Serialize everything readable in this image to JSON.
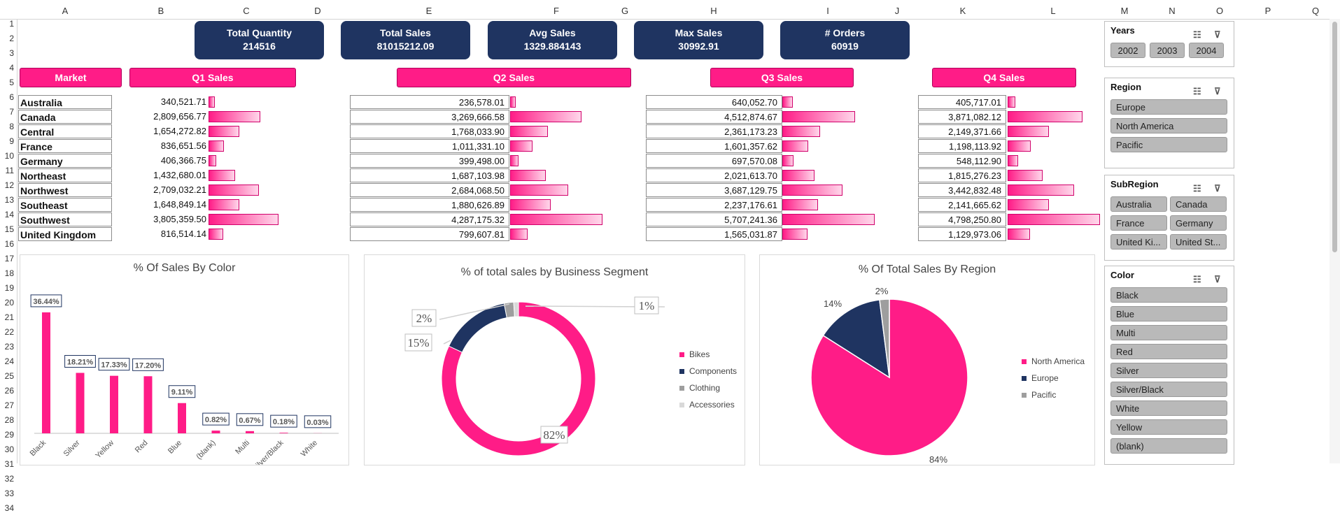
{
  "columns": [
    "A",
    "B",
    "C",
    "D",
    "E",
    "F",
    "G",
    "H",
    "I",
    "J",
    "K",
    "L",
    "M",
    "N",
    "O",
    "P",
    "Q"
  ],
  "rows": [
    "1",
    "2",
    "3",
    "4",
    "5",
    "6",
    "7",
    "8",
    "9",
    "10",
    "11",
    "12",
    "13",
    "14",
    "15",
    "16",
    "17",
    "18",
    "19",
    "20",
    "21",
    "22",
    "23",
    "24",
    "25",
    "26",
    "27",
    "28",
    "29",
    "30",
    "31",
    "32",
    "33",
    "34"
  ],
  "kpis": [
    {
      "title": "Total Quantity",
      "value": "214516"
    },
    {
      "title": "Total Sales",
      "value": "81015212.09"
    },
    {
      "title": "Avg Sales",
      "value": "1329.884143"
    },
    {
      "title": "Max Sales",
      "value": "30992.91"
    },
    {
      "title": "# Orders",
      "value": "60919"
    }
  ],
  "table": {
    "market_header": "Market",
    "quarter_headers": [
      "Q1 Sales",
      "Q2 Sales",
      "Q3 Sales",
      "Q4 Sales"
    ],
    "markets": [
      "Australia",
      "Canada",
      "Central",
      "France",
      "Germany",
      "Northeast",
      "Northwest",
      "Southeast",
      "Southwest",
      "United Kingdom"
    ],
    "values": [
      [
        "340,521.71",
        "2,809,656.77",
        "1,654,272.82",
        "836,651.56",
        "406,366.75",
        "1,432,680.01",
        "2,709,032.21",
        "1,648,849.14",
        "3,805,359.50",
        "816,514.14"
      ],
      [
        "236,578.01",
        "3,269,666.58",
        "1,768,033.90",
        "1,011,331.10",
        "399,498.00",
        "1,687,103.98",
        "2,684,068.50",
        "1,880,626.89",
        "4,287,175.32",
        "799,607.81"
      ],
      [
        "640,052.70",
        "4,512,874.67",
        "2,361,173.23",
        "1,601,357.62",
        "697,570.08",
        "2,021,613.70",
        "3,687,129.75",
        "2,237,176.61",
        "5,707,241.36",
        "1,565,031.87"
      ],
      [
        "405,717.01",
        "3,871,082.12",
        "2,149,371.66",
        "1,198,113.92",
        "548,112.90",
        "1,815,276.23",
        "3,442,832.48",
        "2,141,665.62",
        "4,798,250.80",
        "1,129,973.06"
      ]
    ],
    "bar_fraction": [
      [
        0.08,
        0.66,
        0.39,
        0.2,
        0.1,
        0.34,
        0.64,
        0.39,
        0.89,
        0.19
      ],
      [
        0.06,
        0.77,
        0.41,
        0.24,
        0.09,
        0.39,
        0.63,
        0.44,
        1.0,
        0.19
      ],
      [
        0.11,
        0.79,
        0.41,
        0.28,
        0.12,
        0.35,
        0.65,
        0.39,
        1.0,
        0.27
      ],
      [
        0.08,
        0.81,
        0.45,
        0.25,
        0.11,
        0.38,
        0.72,
        0.45,
        1.0,
        0.24
      ]
    ]
  },
  "charts": {
    "color": {
      "title": "% Of Sales By Color",
      "chart_data": {
        "type": "bar",
        "title": "% Of Sales By Color",
        "categories": [
          "Black",
          "Silver",
          "Yellow",
          "Red",
          "Blue",
          "(blank)",
          "Multi",
          "Silver/Black",
          "White"
        ],
        "values": [
          36.44,
          18.21,
          17.33,
          17.2,
          9.11,
          0.82,
          0.67,
          0.18,
          0.03
        ],
        "labels": [
          "36.44%",
          "18.21%",
          "17.33%",
          "17.20%",
          "9.11%",
          "0.82%",
          "0.67%",
          "0.18%",
          "0.03%"
        ],
        "ylim": [
          0,
          40
        ],
        "color": "#ff1c87"
      }
    },
    "segment": {
      "title": "% of total sales by Business Segment",
      "chart_data": {
        "type": "pie",
        "categories": [
          "Bikes",
          "Components",
          "Clothing",
          "Accessories"
        ],
        "values": [
          82,
          15,
          2,
          1
        ],
        "labels": [
          "82%",
          "15%",
          "2%",
          "1%"
        ],
        "colors": [
          "#ff1c87",
          "#1f3461",
          "#9e9e9e",
          "#d9d9d9"
        ],
        "legend": "right"
      }
    },
    "region": {
      "title": "% Of Total Sales By Region",
      "chart_data": {
        "type": "pie",
        "categories": [
          "North America",
          "Europe",
          "Pacific"
        ],
        "values": [
          84,
          14,
          2
        ],
        "labels": [
          "84%",
          "14%",
          "2%"
        ],
        "colors": [
          "#ff1c87",
          "#1f3461",
          "#9e9e9e"
        ],
        "legend": "right"
      }
    }
  },
  "slicers": [
    {
      "title": "Years",
      "items": [
        "2002",
        "2003",
        "2004"
      ]
    },
    {
      "title": "Region",
      "items": [
        "Europe",
        "North America",
        "Pacific"
      ]
    },
    {
      "title": "SubRegion",
      "items": [
        "Australia",
        "Canada",
        "France",
        "Germany",
        "United Ki...",
        "United St..."
      ]
    },
    {
      "title": "Color",
      "items": [
        "Black",
        "Blue",
        "Multi",
        "Red",
        "Silver",
        "Silver/Black",
        "White",
        "Yellow",
        "(blank)"
      ]
    }
  ],
  "icons": {
    "multiselect": "multi-select-icon",
    "clearfilter": "clear-filter-icon"
  }
}
